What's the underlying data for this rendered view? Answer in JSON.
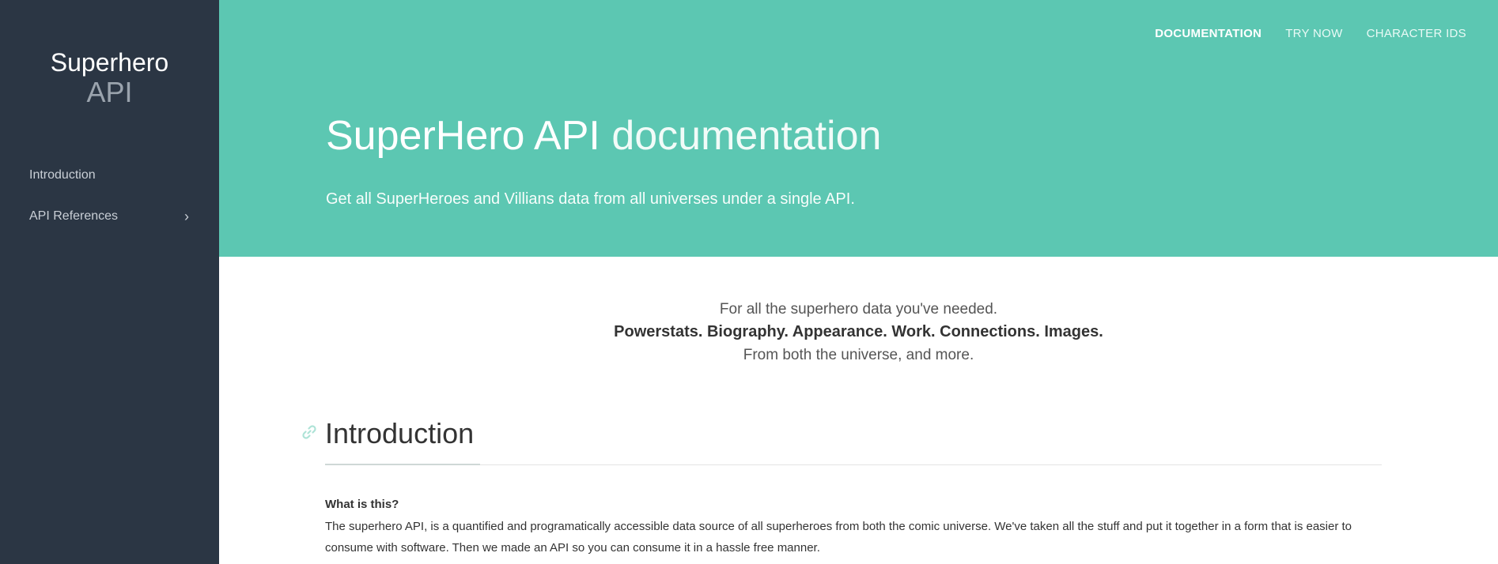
{
  "sidebar": {
    "brand_line1": "Superhero",
    "brand_line2": "API",
    "items": [
      {
        "label": "Introduction"
      },
      {
        "label": "API References",
        "chevron": "›"
      }
    ]
  },
  "topnav": {
    "items": [
      {
        "label": "DOCUMENTATION"
      },
      {
        "label": "TRY NOW"
      },
      {
        "label": "CHARACTER IDS"
      }
    ]
  },
  "hero": {
    "title_main": "SuperHero API",
    "title_light": "documentation",
    "subtitle": "Get all SuperHeroes and Villians data from all universes under a single API."
  },
  "tagline": {
    "line1": "For all the superhero data you've needed.",
    "line2": "Powerstats. Biography. Appearance. Work. Connections. Images.",
    "line3": "From both the universe, and more."
  },
  "intro": {
    "heading": "Introduction",
    "what_title": "What is this?",
    "what_body": "The superhero API, is a quantified and programatically accessible data source of all superheroes from both the comic universe. We've taken all the stuff and put it together in a form that is easier to consume with software. Then we made an API so you can consume it in a hassle free manner."
  },
  "colors": {
    "sidebar_bg": "#2b3644",
    "hero_bg": "#5cc7b2",
    "accent": "#5cc7b2"
  },
  "icons": {
    "chevron": "chevron-right-icon",
    "anchor": "link-icon"
  }
}
